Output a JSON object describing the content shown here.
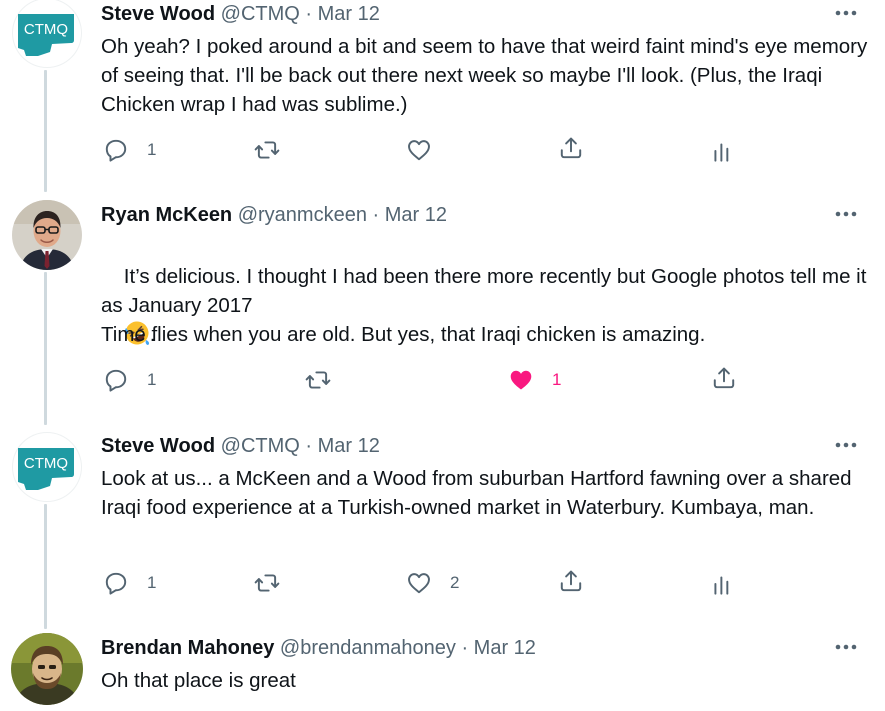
{
  "colors": {
    "text": "#0f1419",
    "secondary": "#536471",
    "like_active": "#f91880",
    "thread_line": "#cfd9de",
    "ctmq_brand": "#1f9aa3"
  },
  "icons": {
    "reply": "reply-icon",
    "retweet": "retweet-icon",
    "like": "heart-icon",
    "share": "share-icon",
    "analytics": "analytics-icon",
    "more": "more-options-icon",
    "emoji": "rolling-on-floor-laughing-emoji"
  },
  "tweets": [
    {
      "name": "Steve Wood",
      "meta": "@CTMQ · Mar 12",
      "avatar_text": "CTMQ",
      "text": "Oh yeah? I poked around a bit and seem to have that weird faint mind's eye memory of seeing that. I'll be back out there next week so maybe I'll look. (Plus, the Iraqi Chicken wrap I had was sublime.)",
      "reply_count": "1",
      "like_count": "",
      "liked": false
    },
    {
      "name": "Ryan McKeen",
      "meta": "@ryanmckeen · Mar 12",
      "text_line1": "It’s delicious. I thought I had been there more recently but Google photos tell me it as January 2017",
      "text_after_emoji": ".",
      "text_line2": "Time flies when you are old. But yes, that Iraqi chicken is amazing.",
      "reply_count": "1",
      "like_count": "1",
      "liked": true
    },
    {
      "name": "Steve Wood",
      "meta": "@CTMQ · Mar 12",
      "avatar_text": "CTMQ",
      "text": "Look at us... a McKeen and a Wood from suburban Hartford fawning over a shared Iraqi food experience at a Turkish-owned market in Waterbury. Kumbaya, man.",
      "reply_count": "1",
      "like_count": "2",
      "liked": false
    },
    {
      "name": "Brendan Mahoney",
      "meta": "@brendanmahoney · Mar 12",
      "text": "Oh that place is great"
    }
  ]
}
